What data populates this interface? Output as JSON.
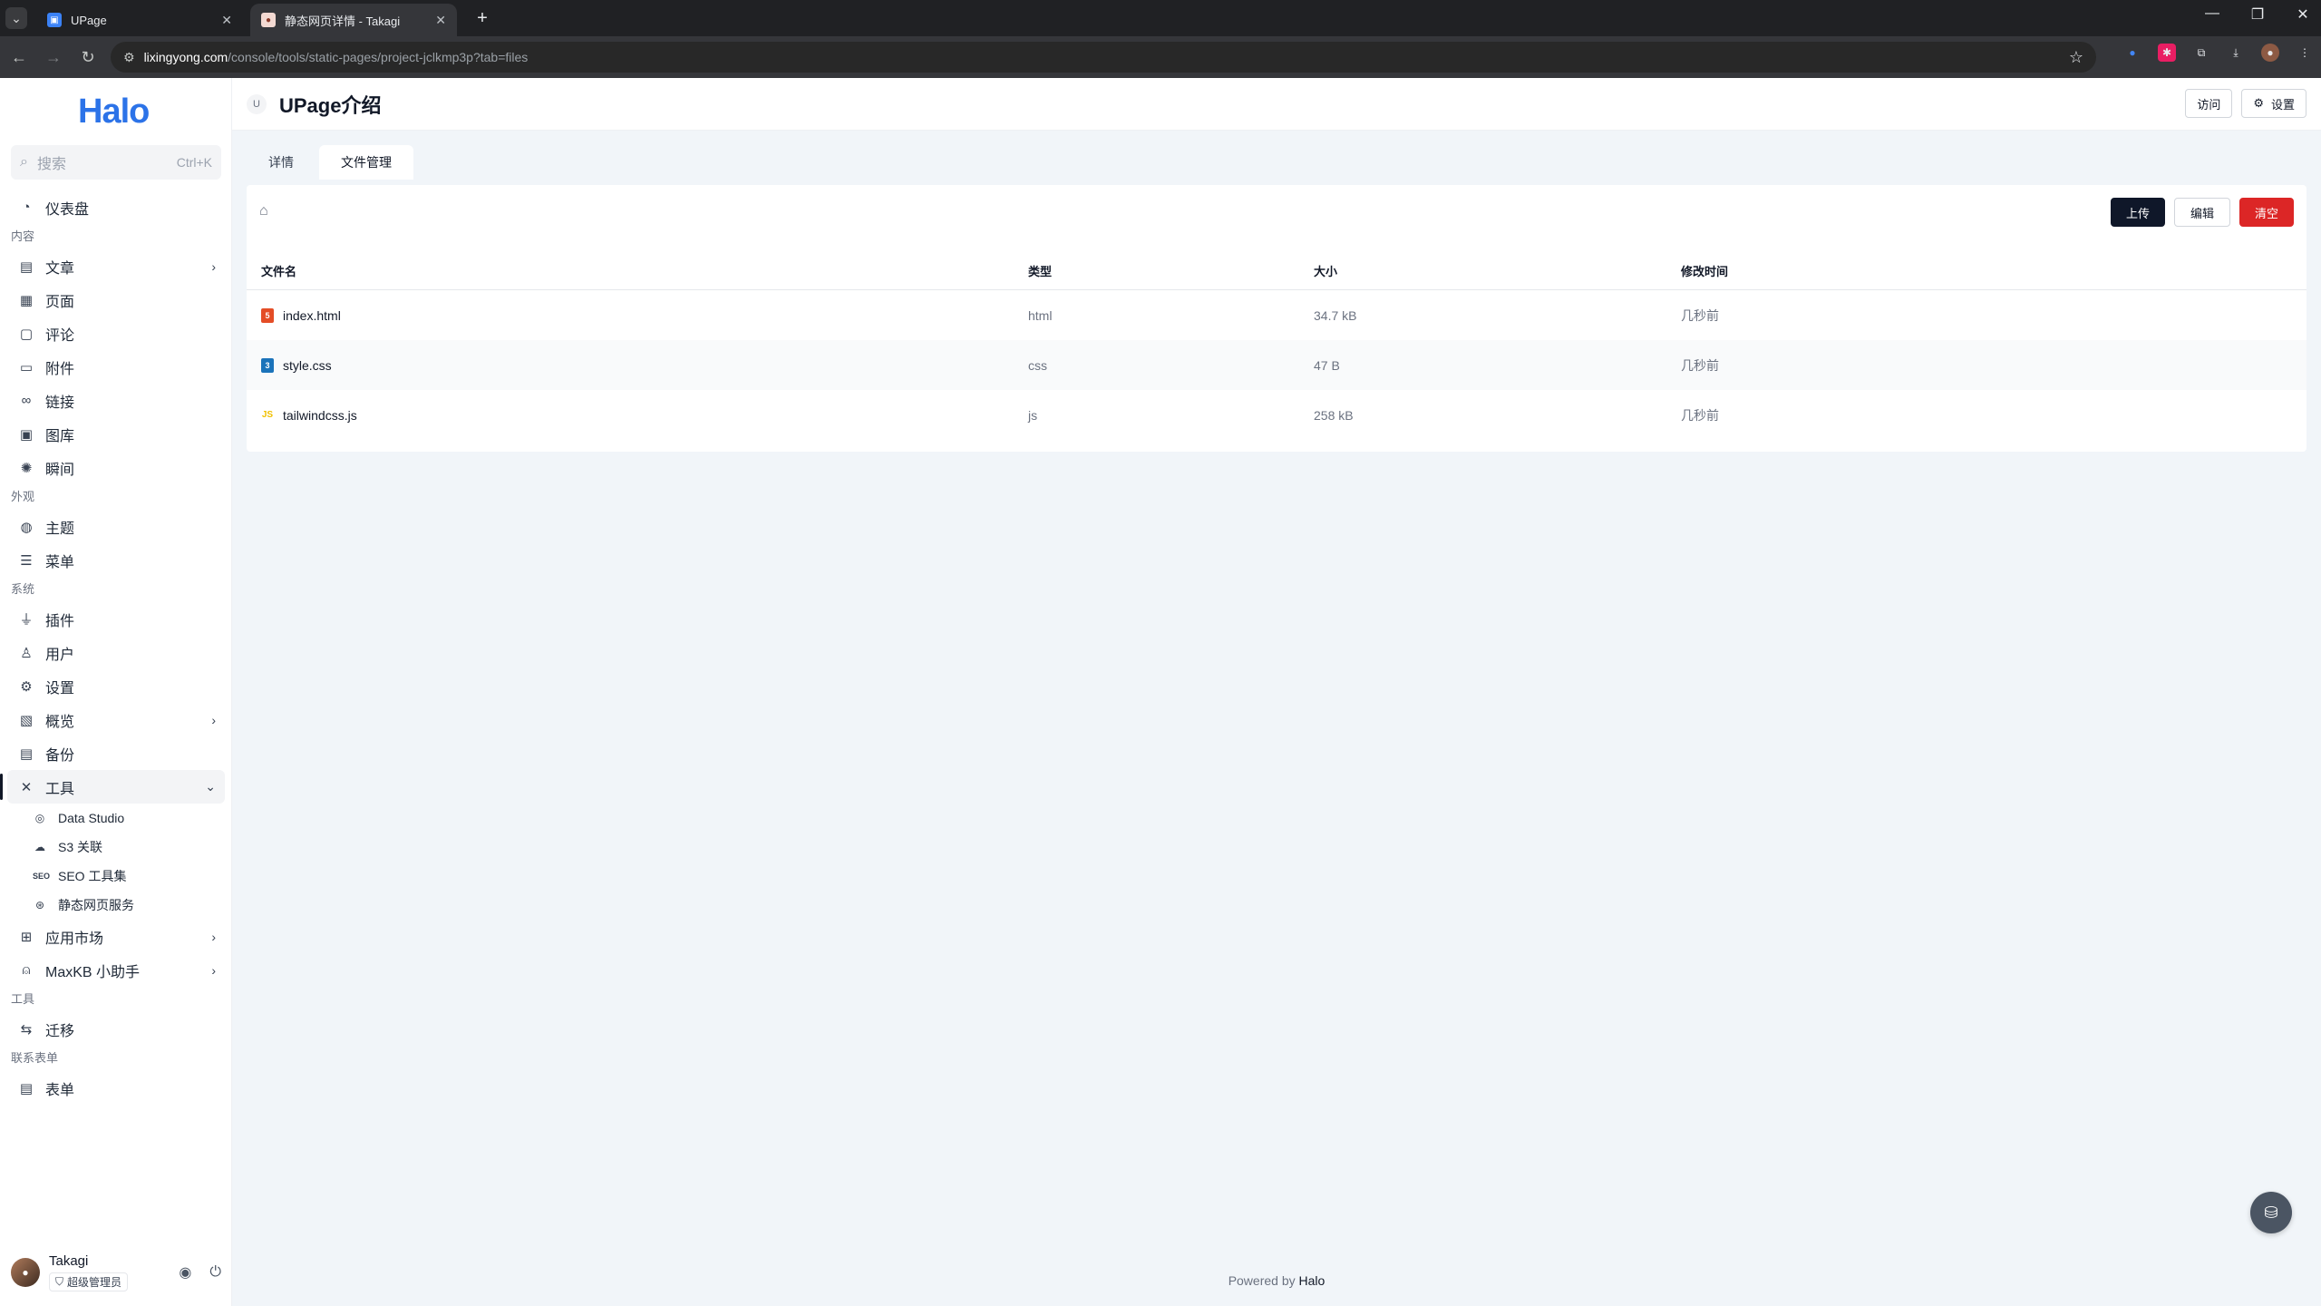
{
  "browser": {
    "tabs": [
      {
        "title": "UPage",
        "icon": "upage-favicon",
        "active": false
      },
      {
        "title": "静态网页详情 - Takagi",
        "icon": "takagi-favicon",
        "active": true
      }
    ],
    "url_host": "lixingyong.com",
    "url_path": "/console/tools/static-pages/project-jclkmp3p?tab=files"
  },
  "sidebar": {
    "logo": "Halo",
    "search_placeholder": "搜索",
    "search_shortcut": "Ctrl+K",
    "dashboard": "仪表盘",
    "groups": {
      "content": "内容",
      "appearance": "外观",
      "system": "系统",
      "tools": "工具",
      "forms": "联系表单"
    },
    "items": {
      "posts": "文章",
      "pages": "页面",
      "comments": "评论",
      "attachments": "附件",
      "links": "链接",
      "gallery": "图库",
      "moments": "瞬间",
      "themes": "主题",
      "menus": "菜单",
      "plugins": "插件",
      "users": "用户",
      "settings": "设置",
      "overview": "概览",
      "backup": "备份",
      "tools": "工具",
      "data_studio": "Data Studio",
      "s3": "S3 关联",
      "seo": "SEO 工具集",
      "static_pages": "静态网页服务",
      "app_market": "应用市场",
      "maxkb": "MaxKB 小助手",
      "migrate": "迁移",
      "forms": "表单"
    },
    "user": {
      "name": "Takagi",
      "role": "超级管理员"
    }
  },
  "header": {
    "badge": "U",
    "title": "UPage介绍",
    "visit_label": "访问",
    "settings_label": "设置"
  },
  "tabs": [
    {
      "label": "详情",
      "active": false
    },
    {
      "label": "文件管理",
      "active": true
    }
  ],
  "actions": {
    "upload": "上传",
    "edit": "编辑",
    "clear": "清空"
  },
  "table": {
    "columns": [
      "文件名",
      "类型",
      "大小",
      "修改时间"
    ],
    "rows": [
      {
        "name": "index.html",
        "type": "html",
        "size": "34.7 kB",
        "modified": "几秒前",
        "icon": "html5-icon"
      },
      {
        "name": "style.css",
        "type": "css",
        "size": "47 B",
        "modified": "几秒前",
        "icon": "css3-icon"
      },
      {
        "name": "tailwindcss.js",
        "type": "js",
        "size": "258 kB",
        "modified": "几秒前",
        "icon": "js-icon"
      }
    ]
  },
  "footer": {
    "prefix": "Powered by",
    "brand": "Halo"
  },
  "colors": {
    "accent": "#2c73e8",
    "primary_button": "#0f1729",
    "danger": "#dc2626"
  }
}
